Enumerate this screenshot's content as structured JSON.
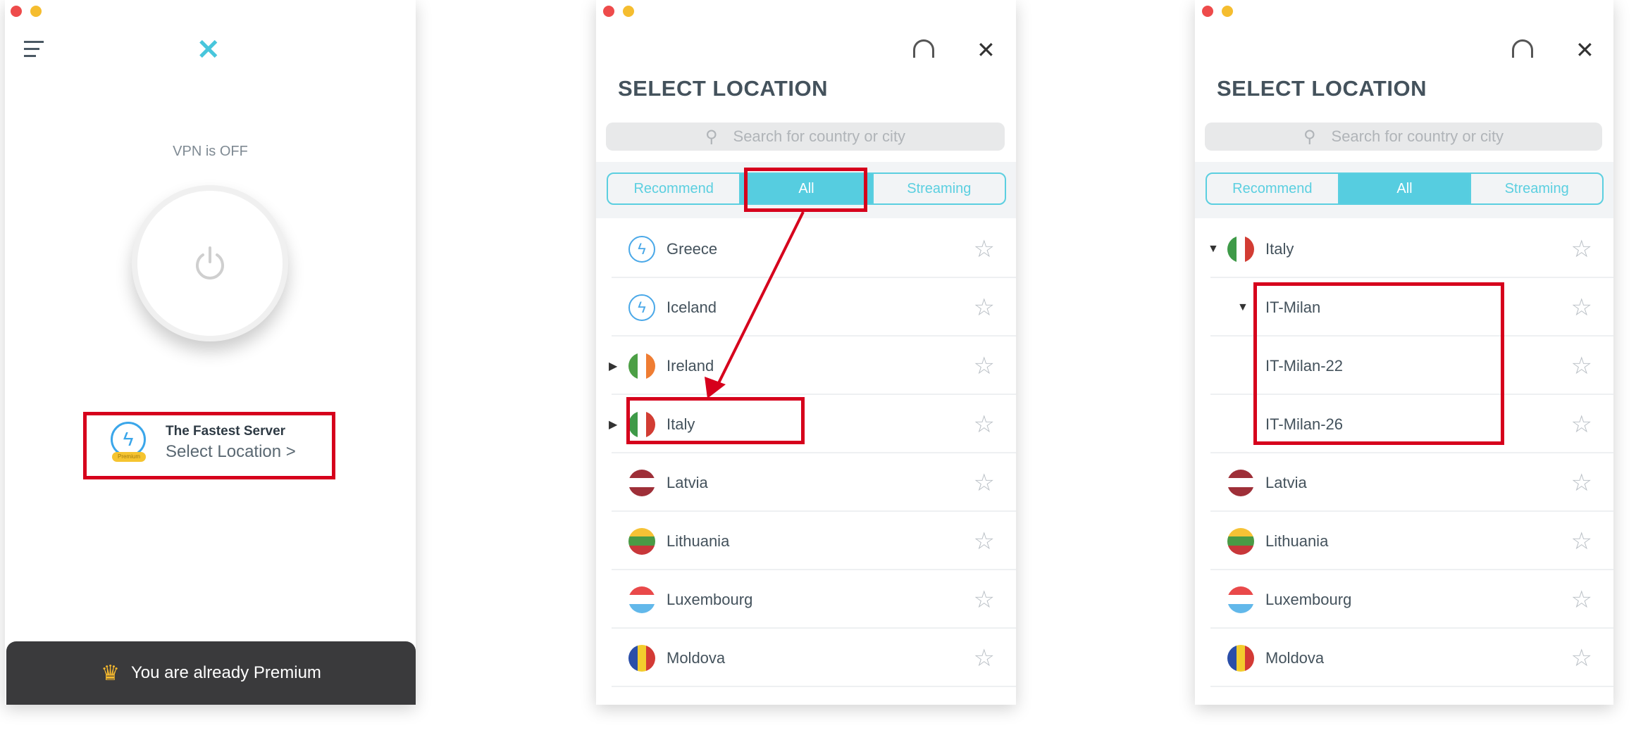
{
  "home": {
    "vpn_status": "VPN is OFF",
    "fastest_title": "The Fastest Server",
    "select_location": "Select Location >",
    "premium_badge": "Premium",
    "premium_banner": "You are already Premium"
  },
  "locations_a": {
    "title": "SELECT LOCATION",
    "search_placeholder": "Search for country or city",
    "tabs": [
      "Recommend",
      "All",
      "Streaming"
    ],
    "active_tab": "All",
    "rows": [
      {
        "name": "Greece",
        "icon": "bolt"
      },
      {
        "name": "Iceland",
        "icon": "bolt"
      },
      {
        "name": "Ireland",
        "icon": "flag",
        "expander": "collapsed",
        "colors": [
          "#4c9f45",
          "#ffffff",
          "#ef7d33"
        ],
        "dir": "v"
      },
      {
        "name": "Italy",
        "icon": "flag",
        "expander": "collapsed",
        "colors": [
          "#3e9a48",
          "#ffffff",
          "#d23c33"
        ],
        "dir": "v"
      },
      {
        "name": "Latvia",
        "icon": "flag",
        "colors": [
          "#9e2f38",
          "#ffffff",
          "#9e2f38"
        ],
        "dir": "h"
      },
      {
        "name": "Lithuania",
        "icon": "flag",
        "colors": [
          "#f6c235",
          "#4a9a45",
          "#c8373a"
        ],
        "dir": "h"
      },
      {
        "name": "Luxembourg",
        "icon": "flag",
        "colors": [
          "#e9494a",
          "#ffffff",
          "#62b8ea"
        ],
        "dir": "h"
      },
      {
        "name": "Moldova",
        "icon": "flag",
        "colors": [
          "#2a4ea8",
          "#f3cd2d",
          "#d33a35"
        ],
        "dir": "v"
      }
    ]
  },
  "locations_b": {
    "title": "SELECT LOCATION",
    "search_placeholder": "Search for country or city",
    "tabs": [
      "Recommend",
      "All",
      "Streaming"
    ],
    "active_tab": "All",
    "rows": [
      {
        "name": "Italy",
        "icon": "flag",
        "expander": "expanded",
        "colors": [
          "#3e9a48",
          "#ffffff",
          "#d23c33"
        ],
        "dir": "v"
      },
      {
        "name": "IT-Milan",
        "icon": "none",
        "expander": "expanded",
        "level": 1
      },
      {
        "name": "IT-Milan-22",
        "icon": "none",
        "level": 2
      },
      {
        "name": "IT-Milan-26",
        "icon": "none",
        "level": 2
      },
      {
        "name": "Latvia",
        "icon": "flag",
        "colors": [
          "#9e2f38",
          "#ffffff",
          "#9e2f38"
        ],
        "dir": "h"
      },
      {
        "name": "Lithuania",
        "icon": "flag",
        "colors": [
          "#f6c235",
          "#4a9a45",
          "#c8373a"
        ],
        "dir": "h"
      },
      {
        "name": "Luxembourg",
        "icon": "flag",
        "colors": [
          "#e9494a",
          "#ffffff",
          "#62b8ea"
        ],
        "dir": "h"
      },
      {
        "name": "Moldova",
        "icon": "flag",
        "colors": [
          "#2a4ea8",
          "#f3cd2d",
          "#d33a35"
        ],
        "dir": "v"
      }
    ]
  },
  "colors": {
    "accent": "#56cde0",
    "highlight": "#d6001c",
    "banner": "#3a3a3c",
    "crown": "#f5b82e"
  }
}
